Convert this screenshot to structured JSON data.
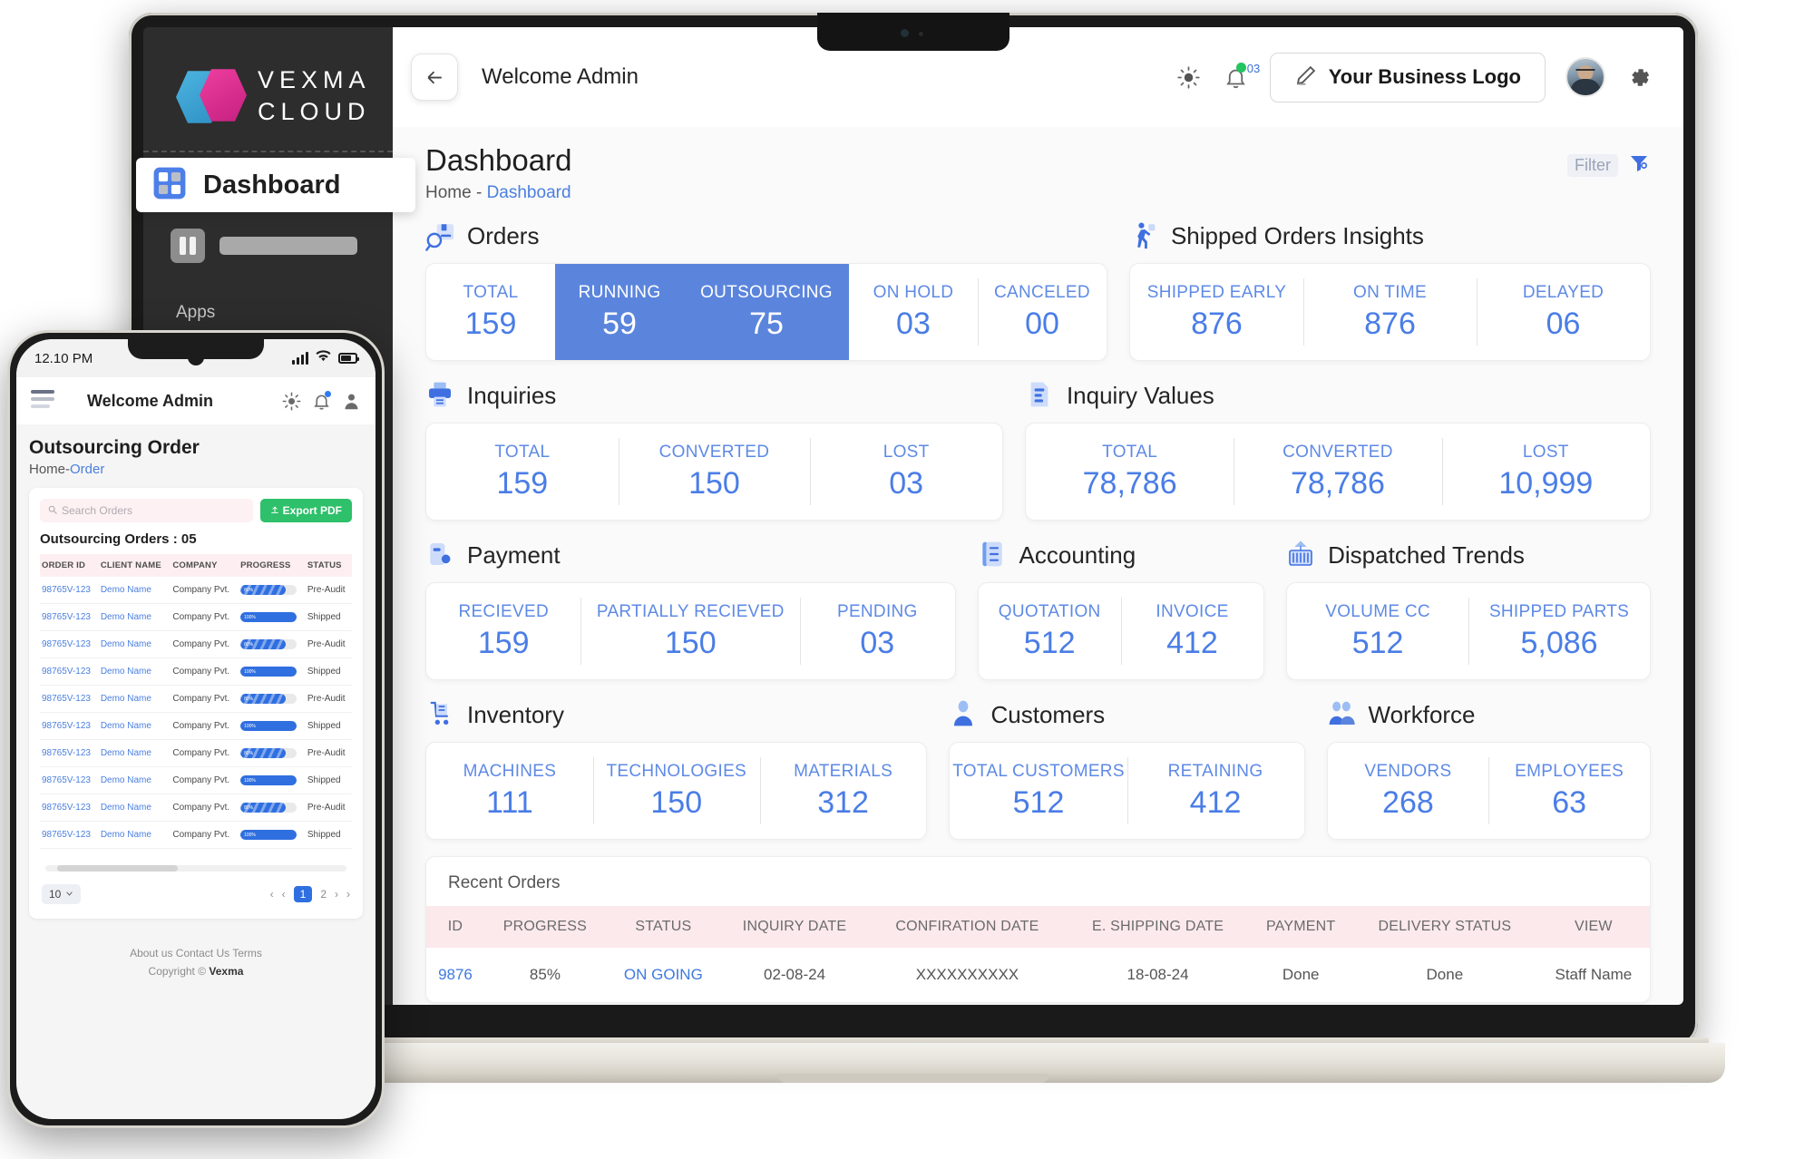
{
  "brand": {
    "line1": "VEXMA",
    "line2": "CLOUD"
  },
  "sidebar": {
    "dashboard_label": "Dashboard",
    "apps_label": "Apps"
  },
  "topbar": {
    "back_icon": "arrow-left-icon",
    "welcome": "Welcome Admin",
    "theme_icon": "sun-theme-icon",
    "bell_icon": "bell-icon",
    "bell_count": "03",
    "logo_button": "Your Business Logo",
    "edit_icon": "pencil-icon",
    "avatar": "user-avatar",
    "settings_icon": "gear-icon"
  },
  "page": {
    "title": "Dashboard",
    "crumb_home": "Home - ",
    "crumb_current": "Dashboard",
    "filter_label": "Filter",
    "filter_icon": "funnel-icon"
  },
  "sections": [
    {
      "id": "orders",
      "title": "Orders",
      "icon": "order-search-icon",
      "stats": [
        {
          "label": "TOTAL",
          "value": "159",
          "highlight": false
        },
        {
          "label": "RUNNING",
          "value": "59",
          "highlight": true
        },
        {
          "label": "OUTSOURCING",
          "value": "75",
          "highlight": true
        },
        {
          "label": "ON HOLD",
          "value": "03",
          "highlight": false
        },
        {
          "label": "CANCELED",
          "value": "00",
          "highlight": false
        }
      ]
    },
    {
      "id": "shipped",
      "title": "Shipped Orders Insights",
      "icon": "walking-delivery-icon",
      "stats": [
        {
          "label": "SHIPPED EARLY",
          "value": "876",
          "highlight": false
        },
        {
          "label": "ON TIME",
          "value": "876",
          "highlight": false
        },
        {
          "label": "DELAYED",
          "value": "06",
          "highlight": false
        }
      ]
    },
    {
      "id": "inquiries",
      "title": "Inquiries",
      "icon": "inquiry-printer-icon",
      "stats": [
        {
          "label": "TOTAL",
          "value": "159",
          "highlight": false
        },
        {
          "label": "CONVERTED",
          "value": "150",
          "highlight": false
        },
        {
          "label": "LOST",
          "value": "03",
          "highlight": false
        }
      ]
    },
    {
      "id": "inquiry-values",
      "title": "Inquiry Values",
      "icon": "bar-document-icon",
      "stats": [
        {
          "label": "TOTAL",
          "value": "78,786",
          "highlight": false
        },
        {
          "label": "CONVERTED",
          "value": "78,786",
          "highlight": false
        },
        {
          "label": "LOST",
          "value": "10,999",
          "highlight": false
        }
      ]
    },
    {
      "id": "payment",
      "title": "Payment",
      "icon": "payment-card-icon",
      "stats": [
        {
          "label": "RECIEVED",
          "value": "159",
          "highlight": false
        },
        {
          "label": "PARTIALLY RECIEVED",
          "value": "150",
          "highlight": false
        },
        {
          "label": "PENDING",
          "value": "03",
          "highlight": false
        }
      ]
    },
    {
      "id": "accounting",
      "title": "Accounting",
      "icon": "accounting-ledger-icon",
      "stats": [
        {
          "label": "QUOTATION",
          "value": "512",
          "highlight": false
        },
        {
          "label": "INVOICE",
          "value": "412",
          "highlight": false
        }
      ]
    },
    {
      "id": "dispatched-trends",
      "title": "Dispatched  Trends",
      "icon": "container-crane-icon",
      "stats": [
        {
          "label": "VOLUME CC",
          "value": "512",
          "highlight": false
        },
        {
          "label": "SHIPPED PARTS",
          "value": "5,086",
          "highlight": false
        }
      ]
    },
    {
      "id": "inventory",
      "title": "Inventory",
      "icon": "inventory-cart-icon",
      "stats": [
        {
          "label": "MACHINES",
          "value": "111",
          "highlight": false
        },
        {
          "label": "TECHNOLOGIES",
          "value": "150",
          "highlight": false
        },
        {
          "label": "MATERIALS",
          "value": "312",
          "highlight": false
        }
      ]
    },
    {
      "id": "customers",
      "title": "Customers",
      "icon": "person-icon",
      "stats": [
        {
          "label": "TOTAL CUSTOMERS",
          "value": "512",
          "highlight": false
        },
        {
          "label": "RETAINING",
          "value": "412",
          "highlight": false
        }
      ]
    },
    {
      "id": "workforce",
      "title": "Workforce",
      "icon": "people-group-icon",
      "stats": [
        {
          "label": "VENDORS",
          "value": "268",
          "highlight": false
        },
        {
          "label": "EMPLOYEES",
          "value": "63",
          "highlight": false
        }
      ]
    }
  ],
  "recent_orders": {
    "title": "Recent Orders",
    "columns": [
      "ID",
      "PROGRESS",
      "STATUS",
      "INQUIRY DATE",
      "CONFIRATION DATE",
      "E. SHIPPING DATE",
      "PAYMENT",
      "DELIVERY STATUS",
      "VIEW"
    ],
    "rows": [
      {
        "id": "9876",
        "progress": "85%",
        "status": "ON GOING",
        "inquiry_date": "02-08-24",
        "confirmation_date": "XXXXXXXXXX",
        "shipping_date": "18-08-24",
        "payment": "Done",
        "delivery_status": "Done",
        "view": "Staff Name"
      }
    ]
  },
  "phone": {
    "status": {
      "time": "12.10 PM",
      "signal_icon": "signal-bars-icon",
      "wifi_icon": "wifi-icon",
      "battery_icon": "battery-icon"
    },
    "header": {
      "menu_icon": "hamburger-menu-icon",
      "welcome": "Welcome Admin",
      "theme_icon": "sun-theme-icon",
      "bell_icon": "bell-icon",
      "profile_icon": "person-icon"
    },
    "page": {
      "title": "Outsourcing Order",
      "crumb_home": "Home-",
      "crumb_current": "Order"
    },
    "search_placeholder": "Search Orders",
    "search_icon": "search-icon",
    "export_label": "Export PDF",
    "export_icon": "upload-icon",
    "count_label": "Outsourcing Orders : 05",
    "columns": [
      "ORDER ID",
      "CLIENT NAME",
      "COMPANY",
      "PROGRESS",
      "STATUS"
    ],
    "rows": [
      {
        "order_id": "98765V-123",
        "client": "Demo Name",
        "company": "Company Pvt.",
        "progress": "80%",
        "status": "Pre-Audit"
      },
      {
        "order_id": "98765V-123",
        "client": "Demo Name",
        "company": "Company Pvt.",
        "progress": "100%",
        "status": "Shipped"
      },
      {
        "order_id": "98765V-123",
        "client": "Demo Name",
        "company": "Company Pvt.",
        "progress": "80%",
        "status": "Pre-Audit"
      },
      {
        "order_id": "98765V-123",
        "client": "Demo Name",
        "company": "Company Pvt.",
        "progress": "100%",
        "status": "Shipped"
      },
      {
        "order_id": "98765V-123",
        "client": "Demo Name",
        "company": "Company Pvt.",
        "progress": "80%",
        "status": "Pre-Audit"
      },
      {
        "order_id": "98765V-123",
        "client": "Demo Name",
        "company": "Company Pvt.",
        "progress": "100%",
        "status": "Shipped"
      },
      {
        "order_id": "98765V-123",
        "client": "Demo Name",
        "company": "Company Pvt.",
        "progress": "80%",
        "status": "Pre-Audit"
      },
      {
        "order_id": "98765V-123",
        "client": "Demo Name",
        "company": "Company Pvt.",
        "progress": "100%",
        "status": "Shipped"
      },
      {
        "order_id": "98765V-123",
        "client": "Demo Name",
        "company": "Company Pvt.",
        "progress": "80%",
        "status": "Pre-Audit"
      },
      {
        "order_id": "98765V-123",
        "client": "Demo Name",
        "company": "Company Pvt.",
        "progress": "100%",
        "status": "Shipped"
      }
    ],
    "per_page": "10",
    "pages": [
      "1",
      "2"
    ],
    "active_page": "1",
    "footer_links": "About us Contact Us Terms",
    "footer_copy": "Copyright © ",
    "footer_brand": "Vexma"
  },
  "colors": {
    "accent_blue": "#4a7de6",
    "highlight_blue": "#5b85dd",
    "table_header_pink": "#fbe9ec",
    "export_green": "#2ec06a",
    "sidebar_dark": "#2d2d2d"
  }
}
